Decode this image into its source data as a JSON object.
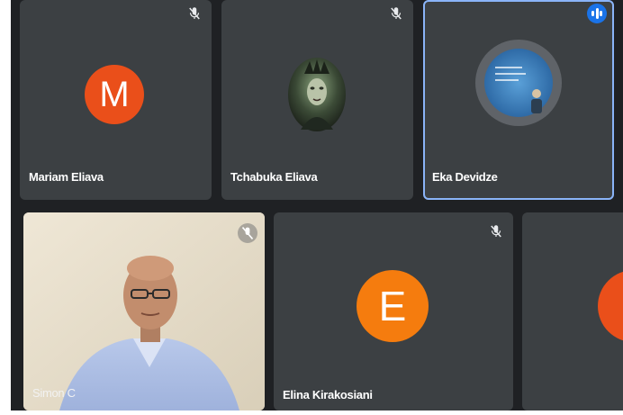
{
  "participants": [
    {
      "name": "Mariam Eliava",
      "initial": "M",
      "avatar_color": "#ea4f1a",
      "muted": true
    },
    {
      "name": "Tchabuka Eliava",
      "avatar": "profile-photo",
      "muted": true
    },
    {
      "name": "Eka Devidze",
      "avatar": "profile-photo",
      "speaking": true
    },
    {
      "name": "Simon C",
      "video": "camera-feed",
      "muted": true
    },
    {
      "name": "Elina Kirakosiani",
      "initial": "E",
      "avatar_color": "#f57c0e",
      "muted": true
    },
    {
      "name": "",
      "initial": "",
      "avatar_color": "#ea4f1a"
    }
  ],
  "colors": {
    "tile_bg": "#3c4043",
    "grid_bg": "#1f2124",
    "active_border": "#8ab4f8",
    "speaking_badge": "#1a73e8"
  }
}
